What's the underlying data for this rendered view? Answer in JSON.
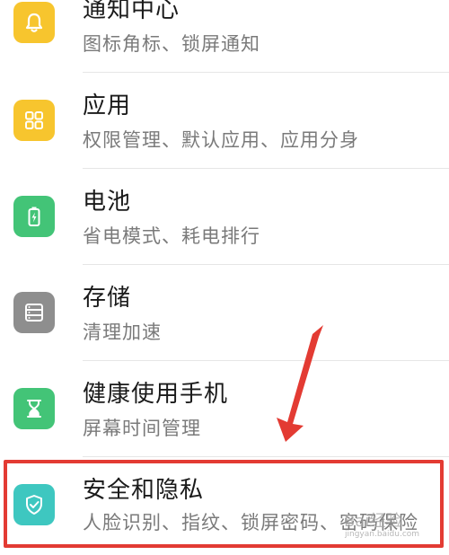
{
  "settings_list": {
    "items": [
      {
        "title": "通知中心",
        "subtitle": "图标角标、锁屏通知",
        "icon": "bell-icon",
        "icon_color": "#F7C52E"
      },
      {
        "title": "应用",
        "subtitle": "权限管理、默认应用、应用分身",
        "icon": "app-grid-icon",
        "icon_color": "#F7C52E"
      },
      {
        "title": "电池",
        "subtitle": "省电模式、耗电排行",
        "icon": "battery-icon",
        "icon_color": "#43C477"
      },
      {
        "title": "存储",
        "subtitle": "清理加速",
        "icon": "storage-icon",
        "icon_color": "#8E8E8E"
      },
      {
        "title": "健康使用手机",
        "subtitle": "屏幕时间管理",
        "icon": "hourglass-icon",
        "icon_color": "#43C477"
      },
      {
        "title": "安全和隐私",
        "subtitle": "人脸识别、指纹、锁屏密码、密码保险",
        "icon": "shield-check-icon",
        "icon_color": "#3EC7C0"
      }
    ]
  },
  "annotation": {
    "highlight_color": "#E33B33",
    "arrow_color": "#E33B33"
  },
  "watermark": {
    "text": "Bai经验",
    "subtext": "jingyan.baidu.com"
  }
}
